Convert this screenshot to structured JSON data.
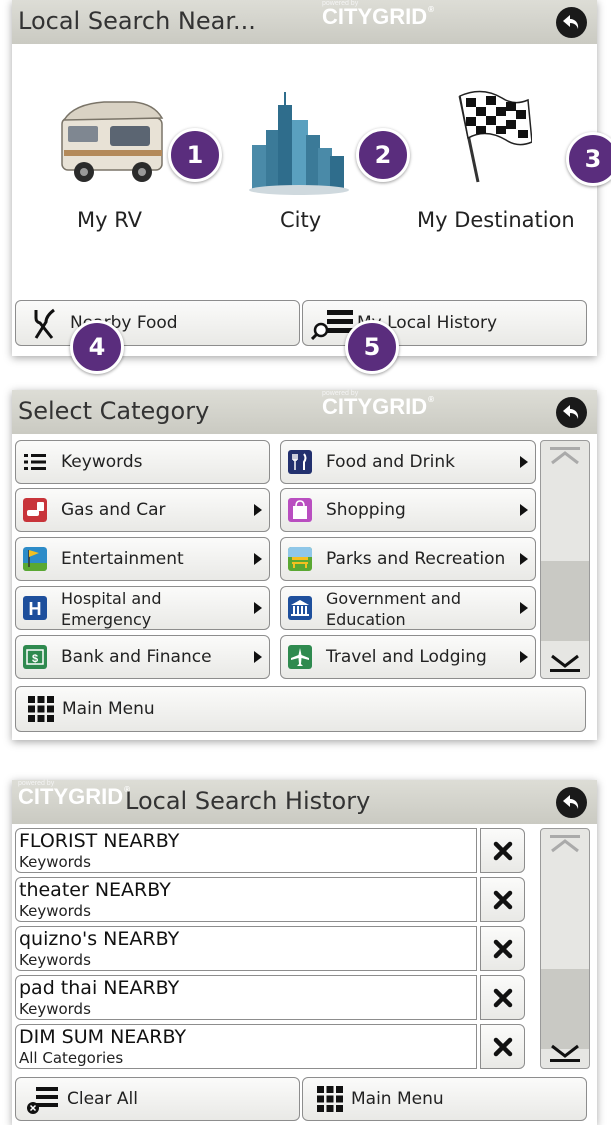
{
  "brand": {
    "powered_by": "powered by",
    "name": "CITYGRID",
    "reg": "®"
  },
  "screen1": {
    "title": "Local Search Near...",
    "options": [
      {
        "label": "My RV",
        "badge": "1",
        "icon": "rv-icon"
      },
      {
        "label": "City",
        "badge": "2",
        "icon": "city-skyline-icon"
      },
      {
        "label": "My Destination",
        "badge": "3",
        "icon": "checkered-flag-icon"
      }
    ],
    "nearby_food": {
      "label": "Nearby Food",
      "badge": "4"
    },
    "local_history": {
      "label": "My Local History",
      "badge": "5"
    }
  },
  "screen2": {
    "title": "Select Category",
    "left": [
      {
        "label": "Keywords",
        "icon": "list-icon",
        "arrow": false
      },
      {
        "label": "Gas and Car",
        "icon": "gas-car-icon",
        "arrow": true
      },
      {
        "label": "Entertainment",
        "icon": "flag-icon",
        "arrow": true
      },
      {
        "label": "Hospital and Emergency",
        "icon": "hospital-icon",
        "arrow": true
      },
      {
        "label": "Bank and Finance",
        "icon": "bank-icon",
        "arrow": true
      }
    ],
    "right": [
      {
        "label": "Food and Drink",
        "icon": "fork-knife-icon",
        "arrow": true
      },
      {
        "label": "Shopping",
        "icon": "shopping-bag-icon",
        "arrow": true
      },
      {
        "label": "Parks and Recreation",
        "icon": "park-bench-icon",
        "arrow": true
      },
      {
        "label": "Government and Education",
        "icon": "government-building-icon",
        "arrow": true
      },
      {
        "label": "Travel and Lodging",
        "icon": "airplane-icon",
        "arrow": true
      }
    ],
    "main_menu": "Main Menu",
    "scroll_position": 0.55
  },
  "screen3": {
    "title": "Local Search History",
    "items": [
      {
        "term": "FLORIST NEARBY",
        "category": "Keywords"
      },
      {
        "term": "theater NEARBY",
        "category": "Keywords"
      },
      {
        "term": "quizno's NEARBY",
        "category": "Keywords"
      },
      {
        "term": "pad thai NEARBY",
        "category": "Keywords"
      },
      {
        "term": "DIM SUM NEARBY",
        "category": "All Categories"
      }
    ],
    "clear_all": "Clear All",
    "main_menu": "Main Menu",
    "scroll_position": 0.6
  },
  "colors": {
    "badge": "#5a2d7d",
    "header": "#d3d3cc",
    "back_button": "#1a1a1a"
  }
}
